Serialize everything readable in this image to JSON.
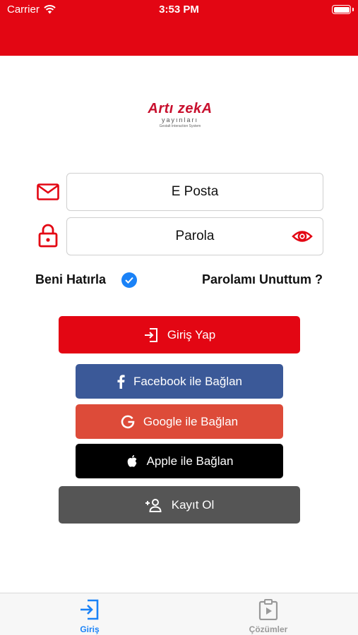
{
  "status_bar": {
    "carrier": "Carrier",
    "time": "3:53 PM"
  },
  "logo": {
    "main": "Artı zekA",
    "sub": "yayınları",
    "tagline": "Gestalt Interaction System"
  },
  "form": {
    "email_placeholder": "E Posta",
    "password_placeholder": "Parola",
    "remember_label": "Beni Hatırla",
    "remember_checked": true,
    "forgot_label": "Parolamı Unuttum ?"
  },
  "buttons": {
    "login": "Giriş Yap",
    "facebook": "Facebook ile Bağlan",
    "google": "Google ile Bağlan",
    "apple": "Apple ile Bağlan",
    "register": "Kayıt Ol"
  },
  "tabbar": {
    "tabs": [
      {
        "label": "Giriş",
        "icon": "login-icon",
        "active": true
      },
      {
        "label": "Çözümler",
        "icon": "solutions-icon",
        "active": false
      }
    ]
  },
  "colors": {
    "brand_red": "#e30613",
    "facebook": "#3b5998",
    "google": "#dd4b39",
    "apple": "#000000",
    "register": "#555555",
    "active_tab": "#1a82f7"
  }
}
